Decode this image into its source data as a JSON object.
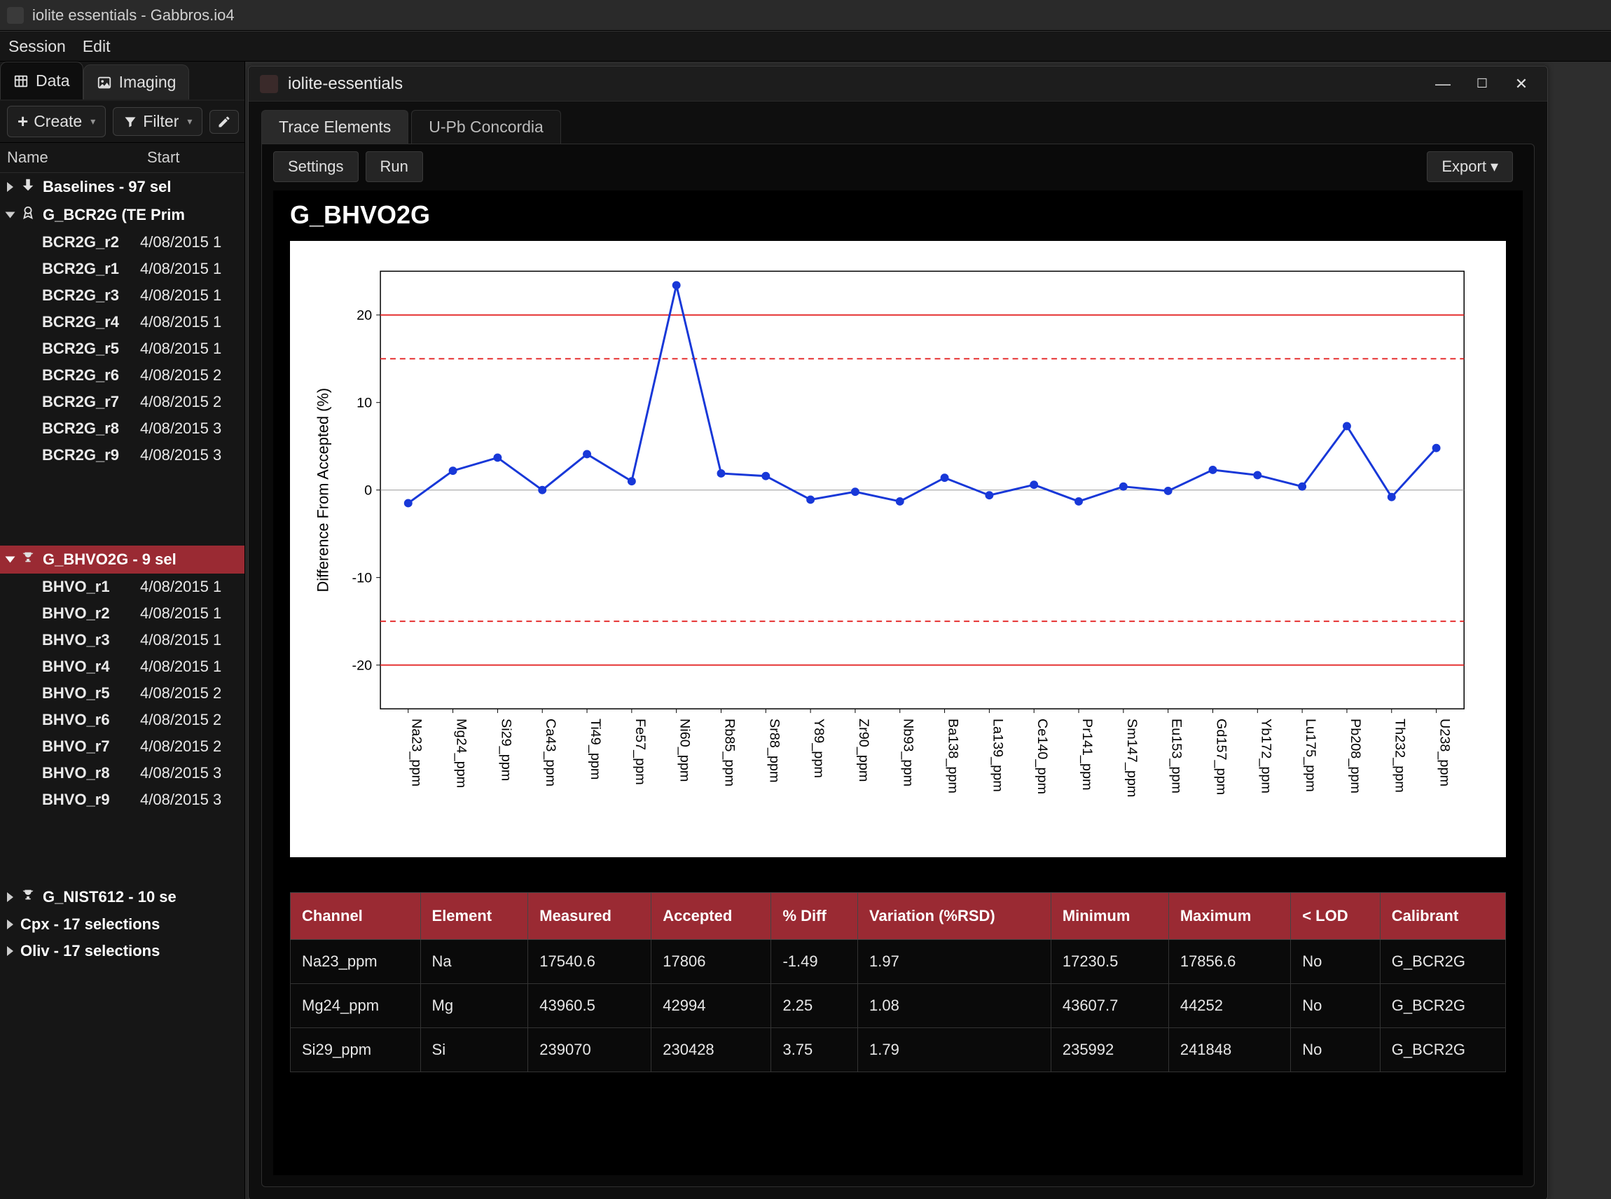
{
  "outer_window": {
    "title": "iolite essentials - Gabbros.io4"
  },
  "menubar": {
    "items": [
      "Session",
      "Edit"
    ]
  },
  "top_tabs": {
    "data": "Data",
    "imaging": "Imaging"
  },
  "toolbar": {
    "create": "Create",
    "filter": "Filter"
  },
  "columns": {
    "name": "Name",
    "start": "Start"
  },
  "tree": {
    "groups": [
      {
        "label": "Baselines - 97 sel",
        "icon": "down-arrow-icon",
        "expanded": false
      },
      {
        "label": "G_BCR2G (TE Prim",
        "icon": "badge-icon",
        "expanded": true,
        "items": [
          {
            "name": "BCR2G_r2",
            "date": "4/08/2015 1"
          },
          {
            "name": "BCR2G_r1",
            "date": "4/08/2015 1"
          },
          {
            "name": "BCR2G_r3",
            "date": "4/08/2015 1"
          },
          {
            "name": "BCR2G_r4",
            "date": "4/08/2015 1"
          },
          {
            "name": "BCR2G_r5",
            "date": "4/08/2015 1"
          },
          {
            "name": "BCR2G_r6",
            "date": "4/08/2015 2"
          },
          {
            "name": "BCR2G_r7",
            "date": "4/08/2015 2"
          },
          {
            "name": "BCR2G_r8",
            "date": "4/08/2015 3"
          },
          {
            "name": "BCR2G_r9",
            "date": "4/08/2015 3"
          }
        ]
      },
      {
        "label": "G_BHVO2G - 9 sel",
        "icon": "trophy-icon",
        "expanded": true,
        "red": true,
        "items": [
          {
            "name": "BHVO_r1",
            "date": "4/08/2015 1"
          },
          {
            "name": "BHVO_r2",
            "date": "4/08/2015 1"
          },
          {
            "name": "BHVO_r3",
            "date": "4/08/2015 1"
          },
          {
            "name": "BHVO_r4",
            "date": "4/08/2015 1"
          },
          {
            "name": "BHVO_r5",
            "date": "4/08/2015 2"
          },
          {
            "name": "BHVO_r6",
            "date": "4/08/2015 2"
          },
          {
            "name": "BHVO_r7",
            "date": "4/08/2015 2"
          },
          {
            "name": "BHVO_r8",
            "date": "4/08/2015 3"
          },
          {
            "name": "BHVO_r9",
            "date": "4/08/2015 3"
          }
        ]
      },
      {
        "label": "G_NIST612 - 10 se",
        "icon": "trophy-icon",
        "expanded": false
      },
      {
        "label": "Cpx - 17 selections",
        "icon": "",
        "expanded": false
      },
      {
        "label": "Oliv - 17 selections",
        "icon": "",
        "expanded": false
      }
    ]
  },
  "inner_window": {
    "title": "iolite-essentials",
    "tabs": {
      "trace_elements": "Trace Elements",
      "upb": "U-Pb Concordia"
    },
    "settings": "Settings",
    "run": "Run",
    "export": "Export",
    "content_title": "G_BHVO2G"
  },
  "table": {
    "headers": [
      "Channel",
      "Element",
      "Measured",
      "Accepted",
      "% Diff",
      "Variation (%RSD)",
      "Minimum",
      "Maximum",
      "< LOD",
      "Calibrant"
    ],
    "rows": [
      [
        "Na23_ppm",
        "Na",
        "17540.6",
        "17806",
        "-1.49",
        "1.97",
        "17230.5",
        "17856.6",
        "No",
        "G_BCR2G"
      ],
      [
        "Mg24_ppm",
        "Mg",
        "43960.5",
        "42994",
        "2.25",
        "1.08",
        "43607.7",
        "44252",
        "No",
        "G_BCR2G"
      ],
      [
        "Si29_ppm",
        "Si",
        "239070",
        "230428",
        "3.75",
        "1.79",
        "235992",
        "241848",
        "No",
        "G_BCR2G"
      ]
    ]
  },
  "chart_data": {
    "type": "line",
    "title": "",
    "ylabel": "Difference From Accepted (%)",
    "ylim": [
      -25,
      25
    ],
    "yticks": [
      -20,
      -10,
      0,
      10,
      20
    ],
    "ref_lines_solid": [
      -20,
      20
    ],
    "ref_lines_dashed": [
      -15,
      15
    ],
    "categories": [
      "Na23_ppm",
      "Mg24_ppm",
      "Si29_ppm",
      "Ca43_ppm",
      "Ti49_ppm",
      "Fe57_ppm",
      "Ni60_ppm",
      "Rb85_ppm",
      "Sr88_ppm",
      "Y89_ppm",
      "Zr90_ppm",
      "Nb93_ppm",
      "Ba138_ppm",
      "La139_ppm",
      "Ce140_ppm",
      "Pr141_ppm",
      "Sm147_ppm",
      "Eu153_ppm",
      "Gd157_ppm",
      "Yb172_ppm",
      "Lu175_ppm",
      "Pb208_ppm",
      "Th232_ppm",
      "U238_ppm"
    ],
    "values": [
      -1.5,
      2.2,
      3.7,
      0.0,
      4.1,
      1.0,
      23.4,
      1.9,
      1.6,
      -1.1,
      -0.2,
      -1.3,
      1.4,
      -0.6,
      0.6,
      -1.3,
      0.4,
      -0.1,
      2.3,
      1.7,
      0.4,
      7.3,
      -0.8,
      4.8
    ]
  }
}
